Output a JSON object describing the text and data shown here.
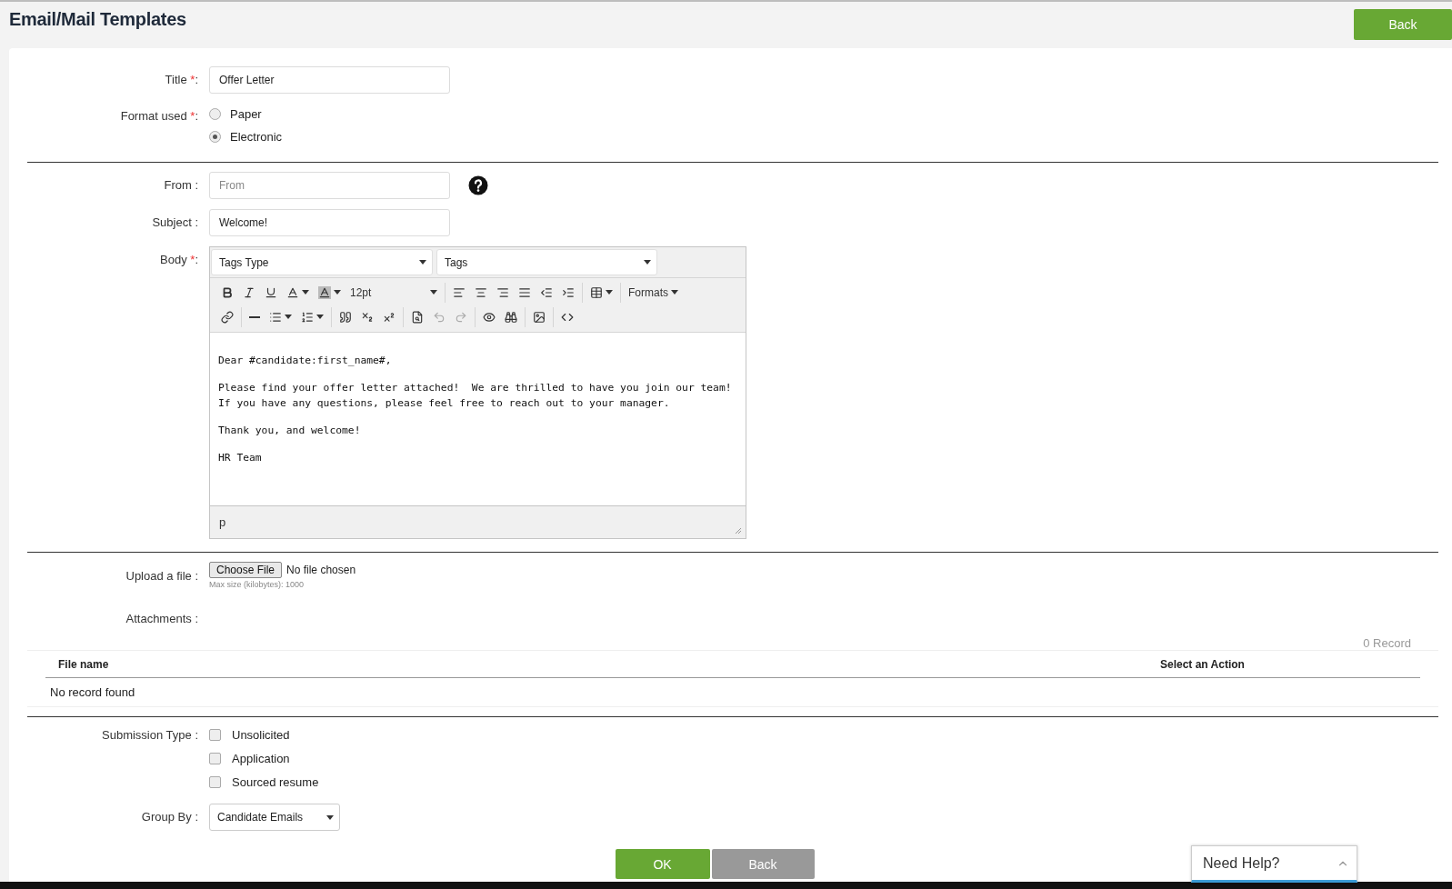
{
  "header": {
    "title": "Email/Mail Templates",
    "back_button": "Back"
  },
  "title_field": {
    "label": "Title",
    "mark": "*",
    "suffix": ":",
    "value": "Offer Letter"
  },
  "format": {
    "label": "Format used",
    "mark": "*",
    "suffix": ":",
    "options": [
      {
        "label": "Paper",
        "selected": false
      },
      {
        "label": "Electronic",
        "selected": true
      }
    ]
  },
  "from_field": {
    "label": "From :",
    "placeholder": "From"
  },
  "subject_field": {
    "label": "Subject :",
    "value": "Welcome!"
  },
  "body": {
    "label": "Body",
    "mark": "*",
    "suffix": ":",
    "tag_selects": [
      "Tags Type",
      "Tags"
    ],
    "toolbar_rows": [
      [
        [
          {
            "kind": "bold",
            "disabled": false
          },
          {
            "kind": "italic",
            "disabled": false
          },
          {
            "kind": "underline",
            "disabled": false
          },
          {
            "kind": "forecolor",
            "disabled": false
          },
          {
            "kind": "backcolor",
            "disabled": false
          },
          {
            "kind": "fontsize",
            "text": "12pt",
            "disabled": false
          }
        ],
        [
          {
            "kind": "alignleft",
            "disabled": false
          },
          {
            "kind": "aligncenter",
            "disabled": false
          },
          {
            "kind": "alignright",
            "disabled": false
          },
          {
            "kind": "alignjustify",
            "disabled": false
          },
          {
            "kind": "outdent",
            "disabled": false
          },
          {
            "kind": "indent",
            "disabled": false
          }
        ],
        [
          {
            "kind": "table",
            "disabled": false
          }
        ],
        [
          {
            "kind": "formats",
            "text": "Formats",
            "disabled": false
          }
        ]
      ],
      [
        [
          {
            "kind": "link",
            "disabled": false
          }
        ],
        [
          {
            "kind": "hr",
            "disabled": false
          },
          {
            "kind": "bullist",
            "disabled": false
          },
          {
            "kind": "numlist",
            "disabled": false
          }
        ],
        [
          {
            "kind": "blockquote",
            "disabled": false
          },
          {
            "kind": "subscript",
            "disabled": false
          },
          {
            "kind": "superscript",
            "disabled": false
          }
        ],
        [
          {
            "kind": "searchreplace",
            "disabled": false
          },
          {
            "kind": "undo",
            "disabled": true
          },
          {
            "kind": "redo",
            "disabled": true
          }
        ],
        [
          {
            "kind": "preview",
            "disabled": false
          },
          {
            "kind": "find",
            "disabled": false
          }
        ],
        [
          {
            "kind": "image",
            "disabled": false
          }
        ],
        [
          {
            "kind": "code",
            "disabled": false
          }
        ]
      ]
    ],
    "paragraphs": [
      "Dear #candidate:first_name#,",
      "Please find your offer letter attached!  We are thrilled to have you join our team! If you have any questions, please feel free to reach out to your manager.",
      "Thank you, and welcome!",
      "HR Team"
    ],
    "status_path": "p"
  },
  "upload": {
    "label": "Upload a file :",
    "button": "Choose File",
    "status": "No file chosen",
    "hint": "Max size (kilobytes): 1000"
  },
  "attachments": {
    "label": "Attachments :",
    "count": "0 Record",
    "columns": [
      "File name",
      "Select an Action"
    ],
    "empty": "No record found"
  },
  "submission": {
    "label": "Submission Type :",
    "options": [
      {
        "label": "Unsolicited",
        "checked": false
      },
      {
        "label": "Application",
        "checked": false
      },
      {
        "label": "Sourced resume",
        "checked": false
      }
    ]
  },
  "group_by": {
    "label": "Group By :",
    "value": "Candidate Emails"
  },
  "actions": [
    {
      "kind": "primary",
      "label": "OK"
    },
    {
      "kind": "secondary",
      "label": "Back"
    }
  ],
  "help_widget": {
    "label": "Need Help?"
  }
}
